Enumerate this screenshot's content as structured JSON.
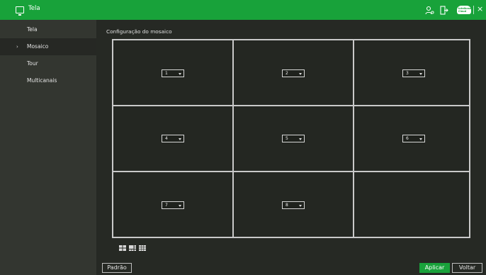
{
  "titlebar": {
    "title": "Tela",
    "cloud_label": "Intelbras Cloud",
    "close_glyph": "×",
    "icons": [
      "monitor-icon",
      "user-settings-icon",
      "exit-icon",
      "cloud-icon",
      "close-icon"
    ],
    "color": "#18a23a"
  },
  "sidebar": {
    "items": [
      {
        "label": "Tela",
        "active": false
      },
      {
        "label": "Mosaico",
        "active": true
      },
      {
        "label": "Tour",
        "active": false
      },
      {
        "label": "Multicanais",
        "active": false
      }
    ],
    "active_arrow": "›"
  },
  "main": {
    "section_title": "Configuração do mosaico",
    "cells": [
      {
        "value": "1"
      },
      {
        "value": "2"
      },
      {
        "value": "3"
      },
      {
        "value": "4"
      },
      {
        "value": "5"
      },
      {
        "value": "6"
      },
      {
        "value": "7"
      },
      {
        "value": "8"
      },
      {
        "value": ""
      }
    ],
    "layout_icons": [
      "grid-4-icon",
      "grid-pip-icon",
      "grid-9-icon"
    ]
  },
  "footer": {
    "default_label": "Padrão",
    "apply_label": "Aplicar",
    "back_label": "Voltar",
    "accent": "#19a23b"
  }
}
